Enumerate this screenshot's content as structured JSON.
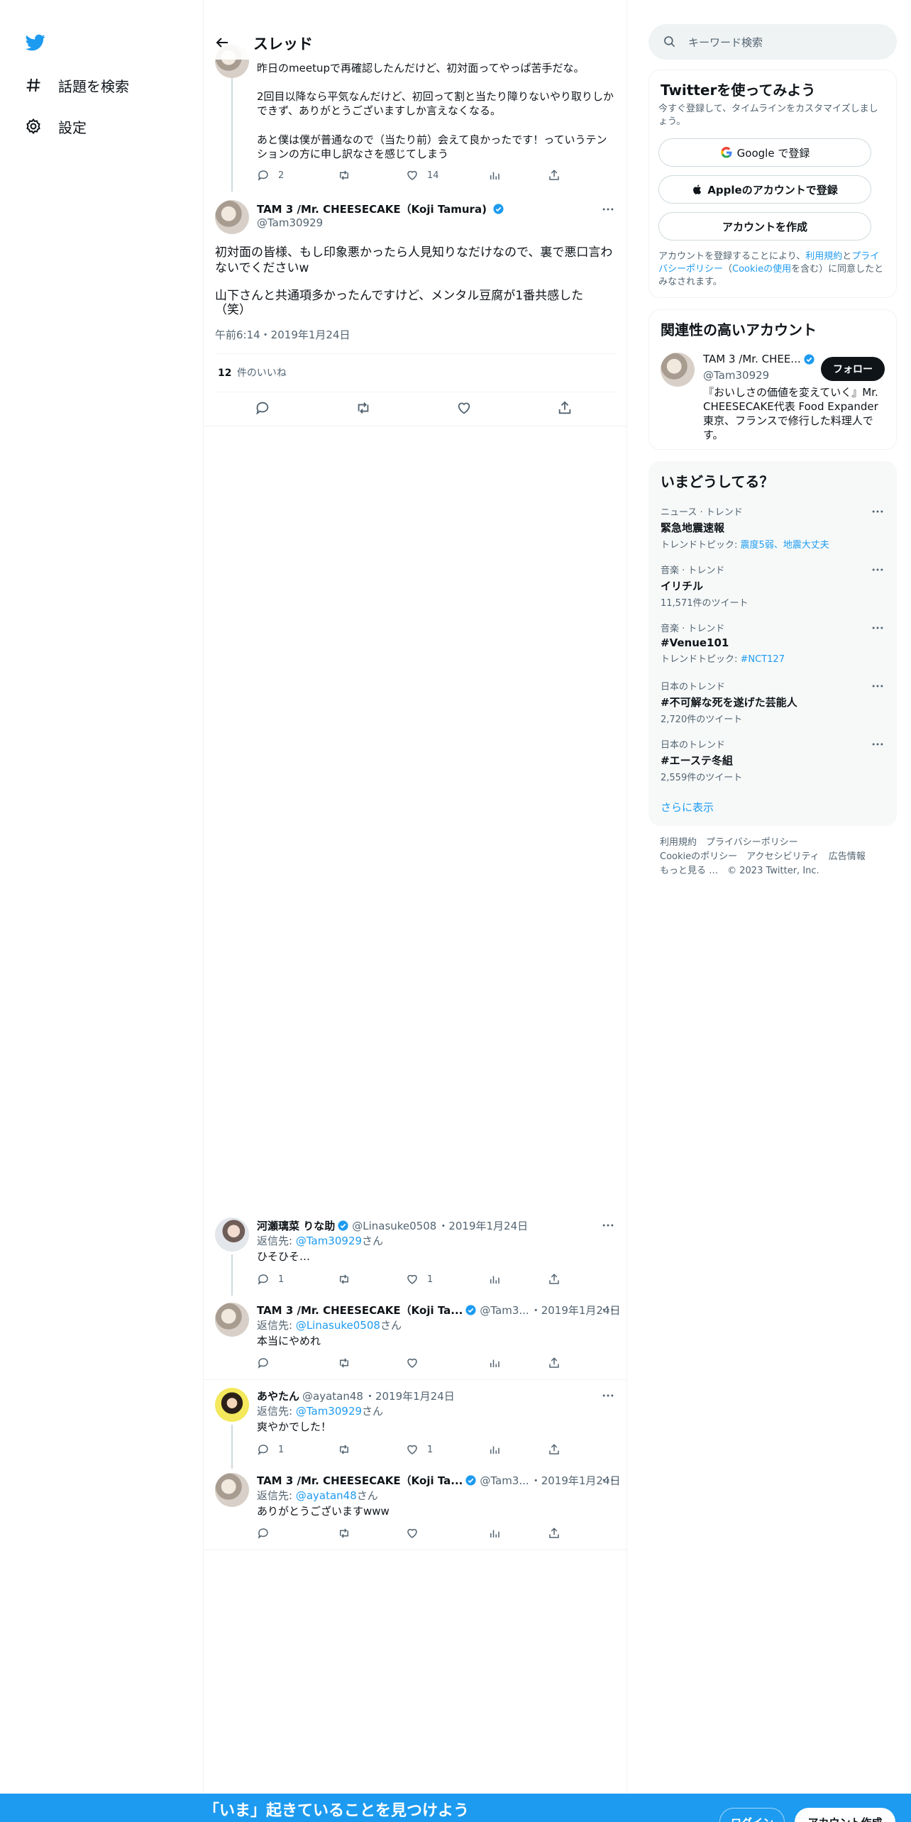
{
  "nav": {
    "items": [
      {
        "label": "話題を検索",
        "icon": "hashtag-icon"
      },
      {
        "label": "設定",
        "icon": "gear-icon"
      }
    ]
  },
  "header": {
    "title": "スレッド"
  },
  "parent_tweet": {
    "text_1": "昨日のmeetupで再確認したんだけど、初対面ってやっぱ苦手だな。",
    "text_2a": "2回目以降なら平気なんだけど、初回って割と当たり障りないやり取りしか",
    "text_2b": "できず、ありがとうございますしか言えなくなる。",
    "text_3a": "あと僕は僕が普通なので（当たり前）会えて良かったです！っていうテン",
    "text_3b": "ションの方に申し訳なさを感じてしまう",
    "replies": "2",
    "retweets": "",
    "likes": "14"
  },
  "main_tweet": {
    "name": "TAM 3 /Mr. CHEESECAKE（Koji Tamura)",
    "handle": "@Tam30929",
    "text_1a": "初対面の皆様、もし印象悪かったら人見知りなだけなので、裏で悪口言わ",
    "text_1b": "ないでくださいw",
    "text_2a": "山下さんと共通項多かったんですけど、メンタル豆腐が1番共感した",
    "text_2b": "（笑）",
    "timestamp": "午前6:14・2019年1月24日",
    "likes_count": "12",
    "likes_label": "件のいいね"
  },
  "replies": [
    {
      "name": "河瀬璃菜 りな助",
      "handle": "@Linasuke0508",
      "date": "・2019年1月24日",
      "reply_to_prefix": "返信先: ",
      "reply_to": "@Tam30929",
      "reply_to_suffix": "さん",
      "text": "ひそひそ…",
      "replies": "1",
      "likes": "1"
    },
    {
      "name": "TAM 3 /Mr. CHEESECAKE（Koji Ta...",
      "handle": "@Tam3...",
      "date": "・2019年1月24日",
      "reply_to_prefix": "返信先: ",
      "reply_to": "@Linasuke0508",
      "reply_to_suffix": "さん",
      "text": "本当にやめれ",
      "replies": "",
      "likes": ""
    },
    {
      "name": "あやたん",
      "handle": "@ayatan48",
      "date": "・2019年1月24日",
      "reply_to_prefix": "返信先: ",
      "reply_to": "@Tam30929",
      "reply_to_suffix": "さん",
      "text": "爽やかでした！",
      "replies": "1",
      "likes": "1"
    },
    {
      "name": "TAM 3 /Mr. CHEESECAKE（Koji Ta...",
      "handle": "@Tam3...",
      "date": "・2019年1月24日",
      "reply_to_prefix": "返信先: ",
      "reply_to": "@ayatan48",
      "reply_to_suffix": "さん",
      "text": "ありがとうございますwww",
      "replies": "",
      "likes": ""
    }
  ],
  "search": {
    "placeholder": "キーワード検索"
  },
  "signup": {
    "title": "Twitterを使ってみよう",
    "subtitle": "今すぐ登録して、タイムラインをカスタマイズしましょう。",
    "google": "Google で登録",
    "apple": "Appleのアカウントで登録",
    "create": "アカウントを作成",
    "terms_1": "アカウントを登録することにより、",
    "terms_link_1": "利用規約",
    "terms_2": "と",
    "terms_link_2": "プライバシーポリシー",
    "terms_3": "（",
    "terms_link_3": "Cookieの使用",
    "terms_4": "を含む）に同意したとみなされます。"
  },
  "related": {
    "title": "関連性の高いアカウント",
    "name": "TAM 3 /Mr. CHEE...",
    "handle": "@Tam30929",
    "follow": "フォロー",
    "bio": "『おいしさの価値を変えていく』Mr. CHEESECAKE代表 Food Expander 東京、フランスで修行した料理人です。"
  },
  "trends": {
    "title": "いまどうしてる？",
    "items": [
      {
        "context": "ニュース · トレンド",
        "name": "緊急地震速報",
        "sub_prefix": "トレンドトピック: ",
        "sub_link": "震度5弱、地震大丈夫",
        "sub": ""
      },
      {
        "context": "音楽 · トレンド",
        "name": "イリチル",
        "sub_prefix": "",
        "sub_link": "",
        "sub": "11,571件のツイート"
      },
      {
        "context": "音楽 · トレンド",
        "name": "#Venue101",
        "sub_prefix": "トレンドトピック: ",
        "sub_link": "#NCT127",
        "sub": ""
      },
      {
        "context": "日本のトレンド",
        "name": "#不可解な死を遂げた芸能人",
        "sub_prefix": "",
        "sub_link": "",
        "sub": "2,720件のツイート"
      },
      {
        "context": "日本のトレンド",
        "name": "#エーステ冬組",
        "sub_prefix": "",
        "sub_link": "",
        "sub": "2,559件のツイート"
      }
    ],
    "show_more": "さらに表示"
  },
  "footer": {
    "line1": "利用規約　プライバシーポリシー",
    "line2": "Cookieのポリシー　アクセシビリティ　広告情報",
    "line3": "もっと見る …　© 2023 Twitter, Inc."
  },
  "bottom": {
    "cta": "「いま」起きていることを見つけよう",
    "login": "ログイン",
    "signup": "アカウント作成"
  },
  "colors": {
    "accent": "#1d9bf0",
    "text": "#0f1419",
    "muted": "#536471",
    "border": "#eff3f4"
  }
}
